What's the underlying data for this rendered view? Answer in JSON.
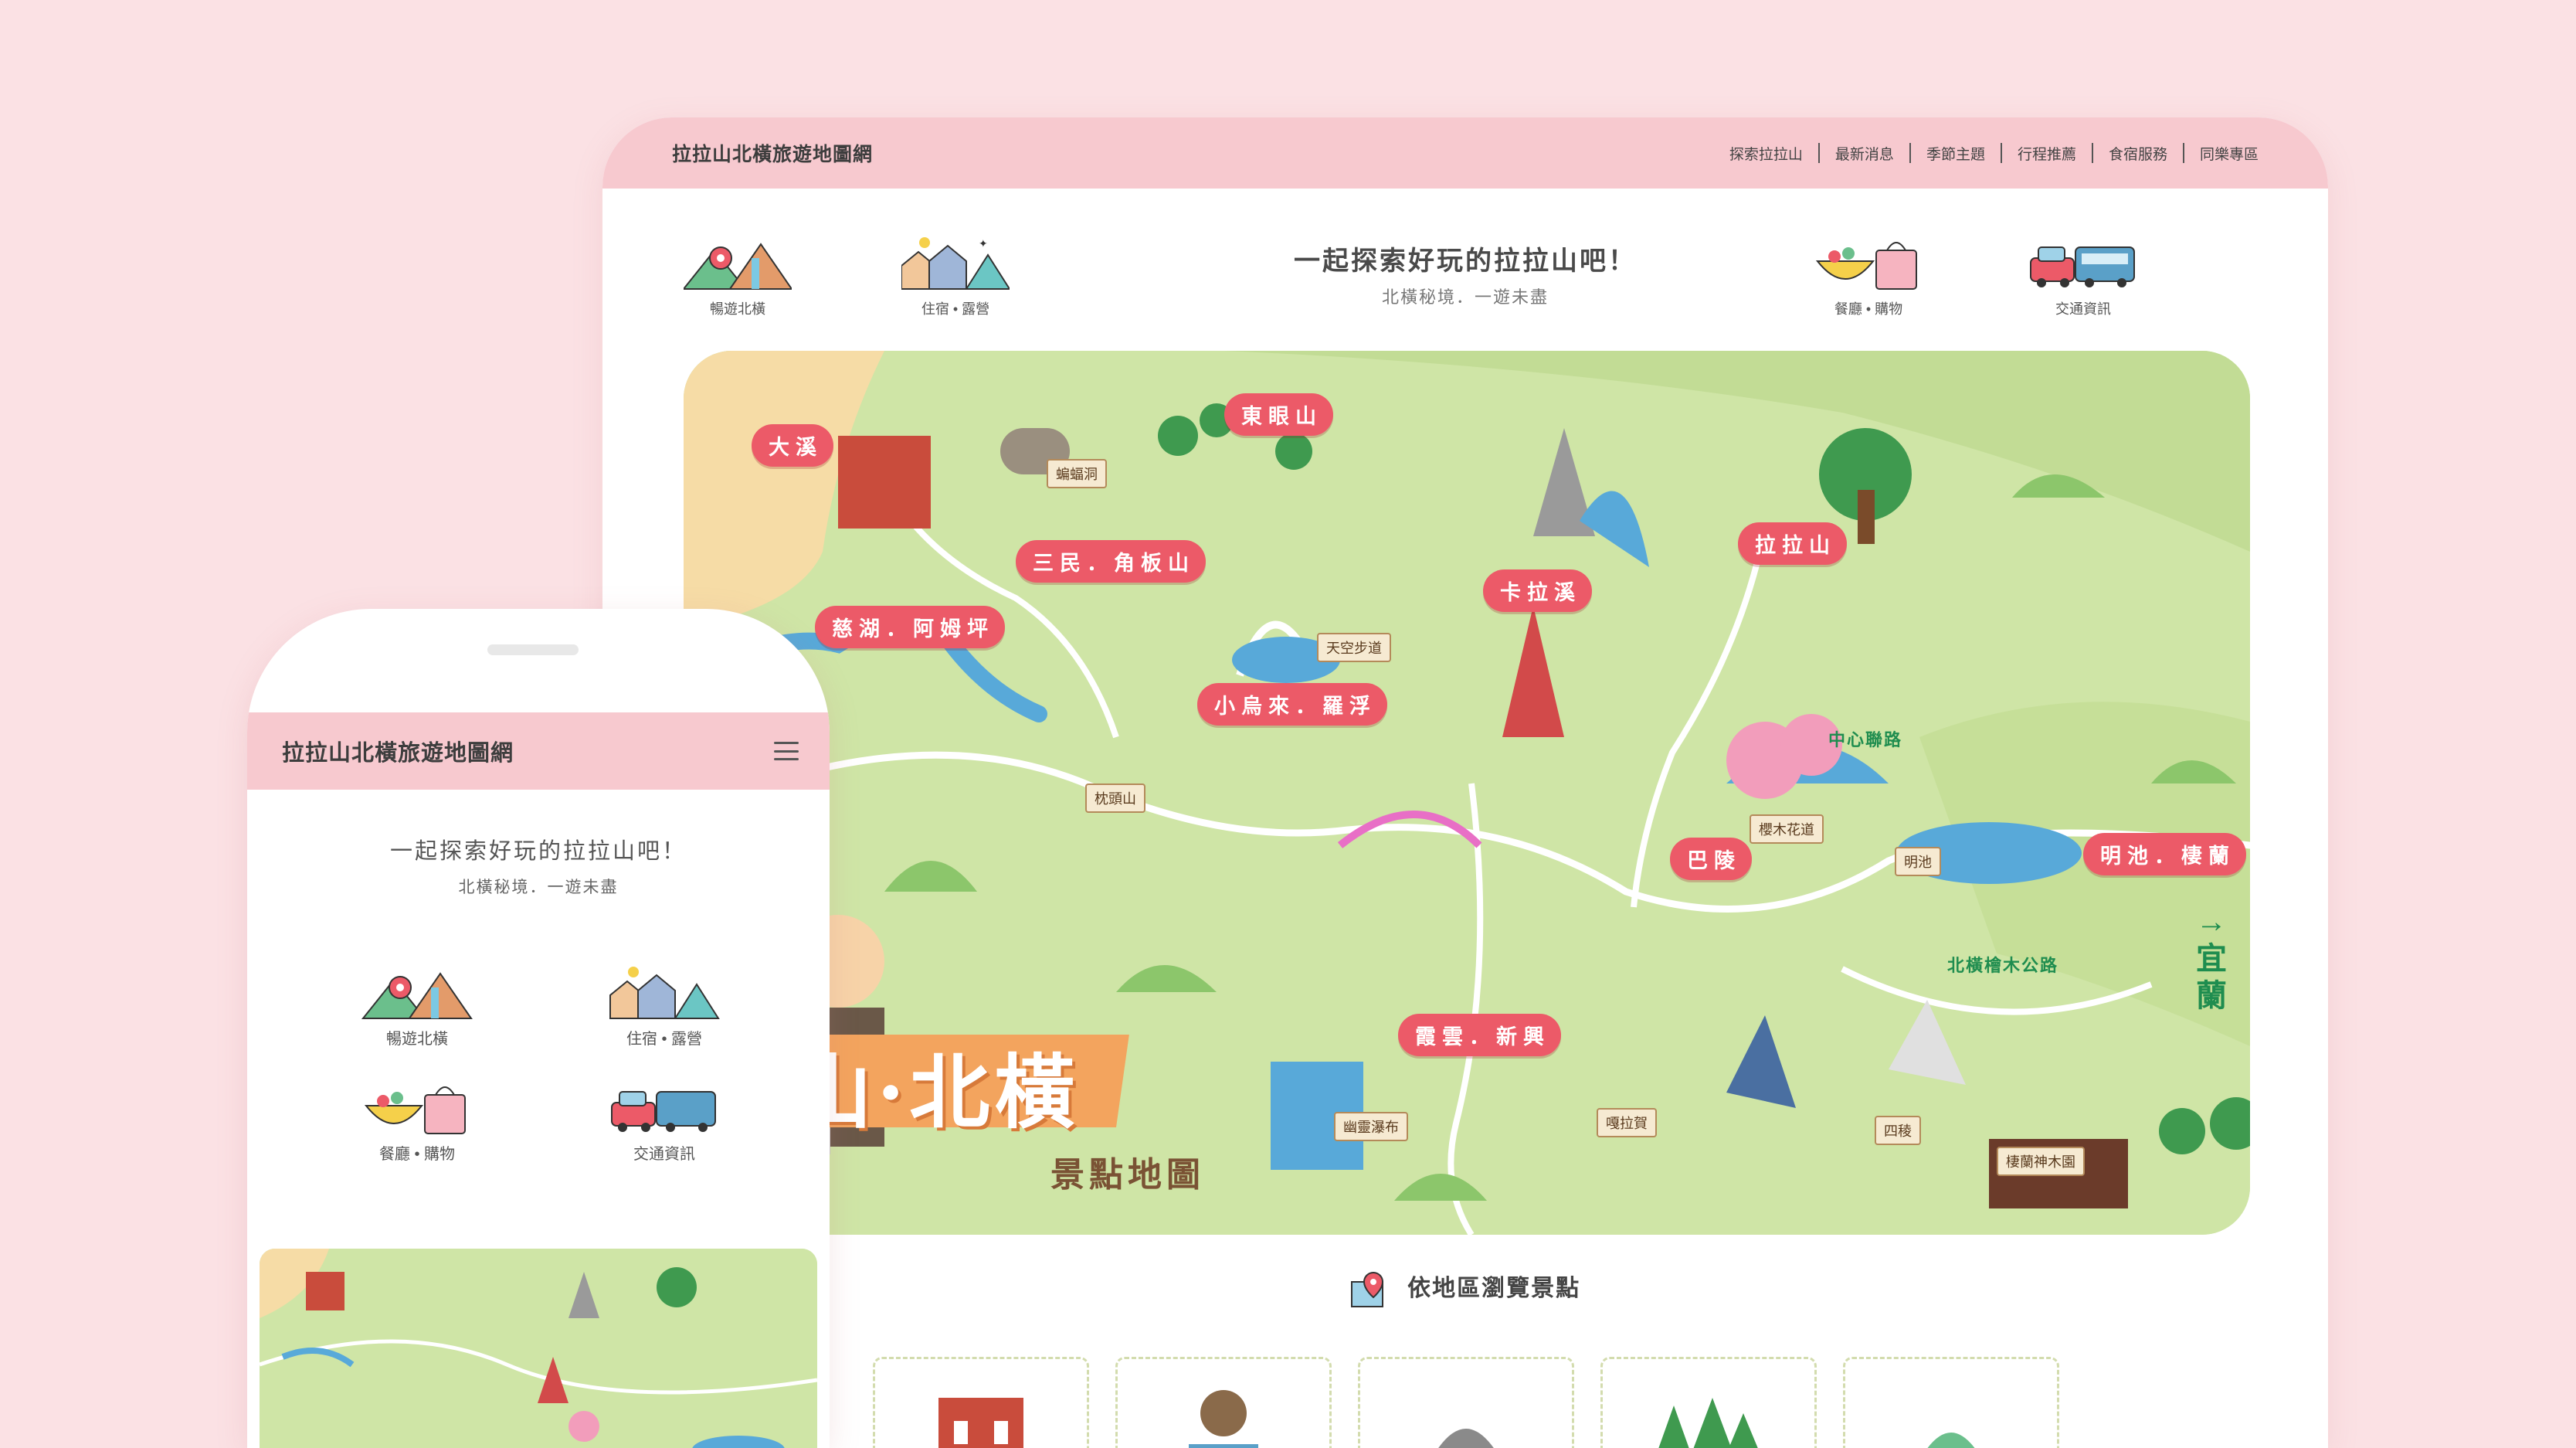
{
  "site_title": "拉拉山北橫旅遊地圖網",
  "desktop": {
    "nav": [
      "探索拉拉山",
      "最新消息",
      "季節主題",
      "行程推薦",
      "食宿服務",
      "同樂專區"
    ],
    "hero": {
      "title": "一起探索好玩的拉拉山吧！",
      "subtitle": "北橫秘境．一遊未盡"
    },
    "quick_links": [
      {
        "label": "暢遊北橫",
        "icon": "mountain-pin-icon"
      },
      {
        "label": "住宿 • 露營",
        "icon": "houses-tent-icon"
      },
      {
        "label": "餐廳 • 購物",
        "icon": "food-bag-icon"
      },
      {
        "label": "交通資訊",
        "icon": "car-bus-icon"
      }
    ],
    "map": {
      "places": [
        "大溪",
        "東眼山",
        "三民．角板山",
        "慈湖．阿姆坪",
        "卡拉溪",
        "拉拉山",
        "小烏來．羅浮",
        "巴陵",
        "明池．棲蘭",
        "霞雲．新興"
      ],
      "signs": [
        "蝙蝠洞",
        "天空步道",
        "櫻木花道",
        "明池",
        "幽靈瀑布",
        "嘎拉賀",
        "四稜",
        "棲蘭神木園",
        "枕頭山"
      ],
      "roads": [
        "中心聯路",
        "北橫檜木公路"
      ],
      "direction": "→宜蘭",
      "title": "拉山·北橫",
      "subtitle": "景點地圖"
    },
    "section_title": "依地區瀏覽景點",
    "colors": {
      "header_bg": "#f7c9cf",
      "page_bg": "#fbe1e4",
      "pin": "#ec5a68",
      "map_green": "#cfe5a6"
    }
  },
  "mobile": {
    "hero": {
      "title": "一起探索好玩的拉拉山吧！",
      "subtitle": "北橫秘境．一遊未盡"
    },
    "quick_links": [
      {
        "label": "暢遊北橫"
      },
      {
        "label": "住宿 • 露營"
      },
      {
        "label": "餐廳 • 購物"
      },
      {
        "label": "交通資訊"
      }
    ]
  }
}
